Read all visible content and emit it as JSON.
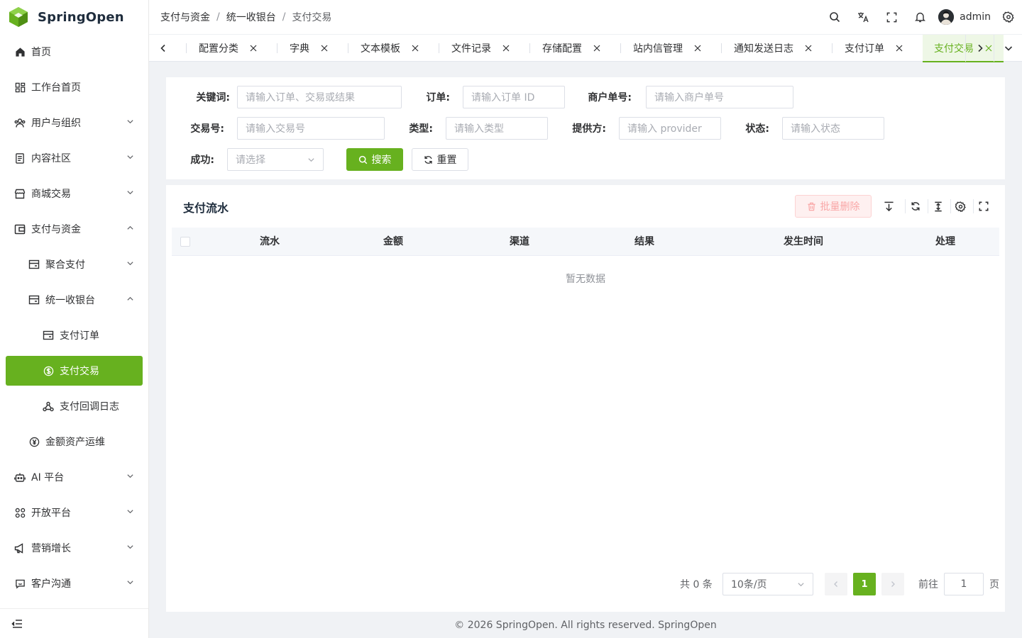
{
  "app": {
    "name": "SpringOpen"
  },
  "sidebar": {
    "items": [
      {
        "label": "首页",
        "icon": "home-icon"
      },
      {
        "label": "工作台首页",
        "icon": "dashboard-icon"
      },
      {
        "label": "用户与组织",
        "icon": "users-icon"
      },
      {
        "label": "内容社区",
        "icon": "document-icon"
      },
      {
        "label": "商城交易",
        "icon": "store-icon"
      },
      {
        "label": "支付与资金",
        "icon": "wallet-icon"
      },
      {
        "label": "聚合支付",
        "icon": "card-icon"
      },
      {
        "label": "统一收银台",
        "icon": "card-icon"
      },
      {
        "label": "支付订单",
        "icon": "card-icon"
      },
      {
        "label": "支付交易",
        "icon": "dollar-circle-icon"
      },
      {
        "label": "支付回调日志",
        "icon": "webhook-icon"
      },
      {
        "label": "金额资产运维",
        "icon": "yen-circle-icon"
      },
      {
        "label": "AI 平台",
        "icon": "robot-icon"
      },
      {
        "label": "开放平台",
        "icon": "grid-icon"
      },
      {
        "label": "营销增长",
        "icon": "megaphone-icon"
      },
      {
        "label": "客户沟通",
        "icon": "chat-icon"
      }
    ]
  },
  "header": {
    "breadcrumb": [
      "支付与资金",
      "统一收银台",
      "支付交易"
    ],
    "breadcrumb_sep": "/",
    "username": "admin"
  },
  "tabs": [
    "配置分类",
    "字典",
    "文本模板",
    "文件记录",
    "存储配置",
    "站内信管理",
    "通知发送日志",
    "支付订单",
    "支付交易"
  ],
  "search": {
    "keyword_label": "关键词:",
    "keyword_placeholder": "请输入订单、交易或结果",
    "order_label": "订单:",
    "order_placeholder": "请输入订单 ID",
    "merchant_label": "商户单号:",
    "merchant_placeholder": "请输入商户单号",
    "txn_label": "交易号:",
    "txn_placeholder": "请输入交易号",
    "type_label": "类型:",
    "type_placeholder": "请输入类型",
    "provider_label": "提供方:",
    "provider_placeholder": "请输入 provider",
    "status_label": "状态:",
    "status_placeholder": "请输入状态",
    "success_label": "成功:",
    "success_placeholder": "请选择",
    "search_button": "搜索",
    "reset_button": "重置"
  },
  "table": {
    "title": "支付流水",
    "batch_delete": "批量删除",
    "columns": [
      "流水",
      "金额",
      "渠道",
      "结果",
      "发生时间",
      "处理"
    ],
    "empty_text": "暂无数据"
  },
  "pagination": {
    "total": "共 0 条",
    "page_size": "10条/页",
    "current_page": "1",
    "goto_label": "前往",
    "goto_value": "1",
    "page_suffix": "页"
  },
  "footer": {
    "text": "© 2026 SpringOpen. All rights reserved. SpringOpen"
  },
  "colors": {
    "primary": "#67b11f",
    "danger_light": "#fef0f0"
  }
}
